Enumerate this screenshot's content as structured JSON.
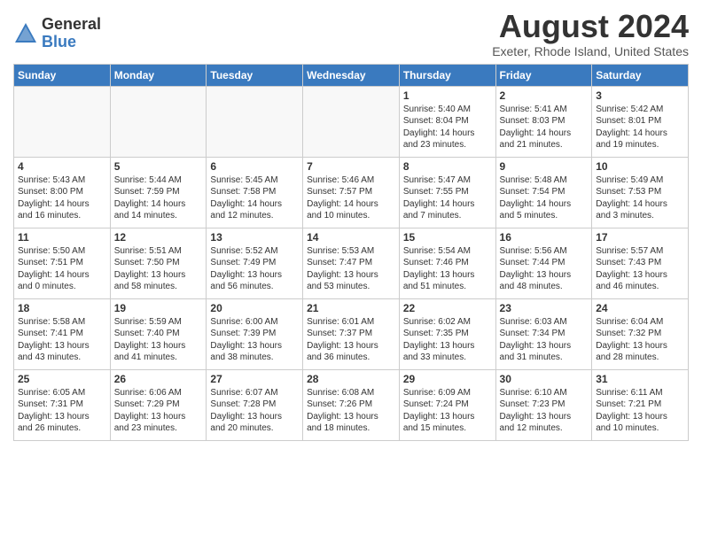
{
  "header": {
    "logo_line1": "General",
    "logo_line2": "Blue",
    "month_title": "August 2024",
    "location": "Exeter, Rhode Island, United States"
  },
  "days_of_week": [
    "Sunday",
    "Monday",
    "Tuesday",
    "Wednesday",
    "Thursday",
    "Friday",
    "Saturday"
  ],
  "weeks": [
    [
      {
        "day": "",
        "content": ""
      },
      {
        "day": "",
        "content": ""
      },
      {
        "day": "",
        "content": ""
      },
      {
        "day": "",
        "content": ""
      },
      {
        "day": "1",
        "content": "Sunrise: 5:40 AM\nSunset: 8:04 PM\nDaylight: 14 hours\nand 23 minutes."
      },
      {
        "day": "2",
        "content": "Sunrise: 5:41 AM\nSunset: 8:03 PM\nDaylight: 14 hours\nand 21 minutes."
      },
      {
        "day": "3",
        "content": "Sunrise: 5:42 AM\nSunset: 8:01 PM\nDaylight: 14 hours\nand 19 minutes."
      }
    ],
    [
      {
        "day": "4",
        "content": "Sunrise: 5:43 AM\nSunset: 8:00 PM\nDaylight: 14 hours\nand 16 minutes."
      },
      {
        "day": "5",
        "content": "Sunrise: 5:44 AM\nSunset: 7:59 PM\nDaylight: 14 hours\nand 14 minutes."
      },
      {
        "day": "6",
        "content": "Sunrise: 5:45 AM\nSunset: 7:58 PM\nDaylight: 14 hours\nand 12 minutes."
      },
      {
        "day": "7",
        "content": "Sunrise: 5:46 AM\nSunset: 7:57 PM\nDaylight: 14 hours\nand 10 minutes."
      },
      {
        "day": "8",
        "content": "Sunrise: 5:47 AM\nSunset: 7:55 PM\nDaylight: 14 hours\nand 7 minutes."
      },
      {
        "day": "9",
        "content": "Sunrise: 5:48 AM\nSunset: 7:54 PM\nDaylight: 14 hours\nand 5 minutes."
      },
      {
        "day": "10",
        "content": "Sunrise: 5:49 AM\nSunset: 7:53 PM\nDaylight: 14 hours\nand 3 minutes."
      }
    ],
    [
      {
        "day": "11",
        "content": "Sunrise: 5:50 AM\nSunset: 7:51 PM\nDaylight: 14 hours\nand 0 minutes."
      },
      {
        "day": "12",
        "content": "Sunrise: 5:51 AM\nSunset: 7:50 PM\nDaylight: 13 hours\nand 58 minutes."
      },
      {
        "day": "13",
        "content": "Sunrise: 5:52 AM\nSunset: 7:49 PM\nDaylight: 13 hours\nand 56 minutes."
      },
      {
        "day": "14",
        "content": "Sunrise: 5:53 AM\nSunset: 7:47 PM\nDaylight: 13 hours\nand 53 minutes."
      },
      {
        "day": "15",
        "content": "Sunrise: 5:54 AM\nSunset: 7:46 PM\nDaylight: 13 hours\nand 51 minutes."
      },
      {
        "day": "16",
        "content": "Sunrise: 5:56 AM\nSunset: 7:44 PM\nDaylight: 13 hours\nand 48 minutes."
      },
      {
        "day": "17",
        "content": "Sunrise: 5:57 AM\nSunset: 7:43 PM\nDaylight: 13 hours\nand 46 minutes."
      }
    ],
    [
      {
        "day": "18",
        "content": "Sunrise: 5:58 AM\nSunset: 7:41 PM\nDaylight: 13 hours\nand 43 minutes."
      },
      {
        "day": "19",
        "content": "Sunrise: 5:59 AM\nSunset: 7:40 PM\nDaylight: 13 hours\nand 41 minutes."
      },
      {
        "day": "20",
        "content": "Sunrise: 6:00 AM\nSunset: 7:39 PM\nDaylight: 13 hours\nand 38 minutes."
      },
      {
        "day": "21",
        "content": "Sunrise: 6:01 AM\nSunset: 7:37 PM\nDaylight: 13 hours\nand 36 minutes."
      },
      {
        "day": "22",
        "content": "Sunrise: 6:02 AM\nSunset: 7:35 PM\nDaylight: 13 hours\nand 33 minutes."
      },
      {
        "day": "23",
        "content": "Sunrise: 6:03 AM\nSunset: 7:34 PM\nDaylight: 13 hours\nand 31 minutes."
      },
      {
        "day": "24",
        "content": "Sunrise: 6:04 AM\nSunset: 7:32 PM\nDaylight: 13 hours\nand 28 minutes."
      }
    ],
    [
      {
        "day": "25",
        "content": "Sunrise: 6:05 AM\nSunset: 7:31 PM\nDaylight: 13 hours\nand 26 minutes."
      },
      {
        "day": "26",
        "content": "Sunrise: 6:06 AM\nSunset: 7:29 PM\nDaylight: 13 hours\nand 23 minutes."
      },
      {
        "day": "27",
        "content": "Sunrise: 6:07 AM\nSunset: 7:28 PM\nDaylight: 13 hours\nand 20 minutes."
      },
      {
        "day": "28",
        "content": "Sunrise: 6:08 AM\nSunset: 7:26 PM\nDaylight: 13 hours\nand 18 minutes."
      },
      {
        "day": "29",
        "content": "Sunrise: 6:09 AM\nSunset: 7:24 PM\nDaylight: 13 hours\nand 15 minutes."
      },
      {
        "day": "30",
        "content": "Sunrise: 6:10 AM\nSunset: 7:23 PM\nDaylight: 13 hours\nand 12 minutes."
      },
      {
        "day": "31",
        "content": "Sunrise: 6:11 AM\nSunset: 7:21 PM\nDaylight: 13 hours\nand 10 minutes."
      }
    ]
  ]
}
